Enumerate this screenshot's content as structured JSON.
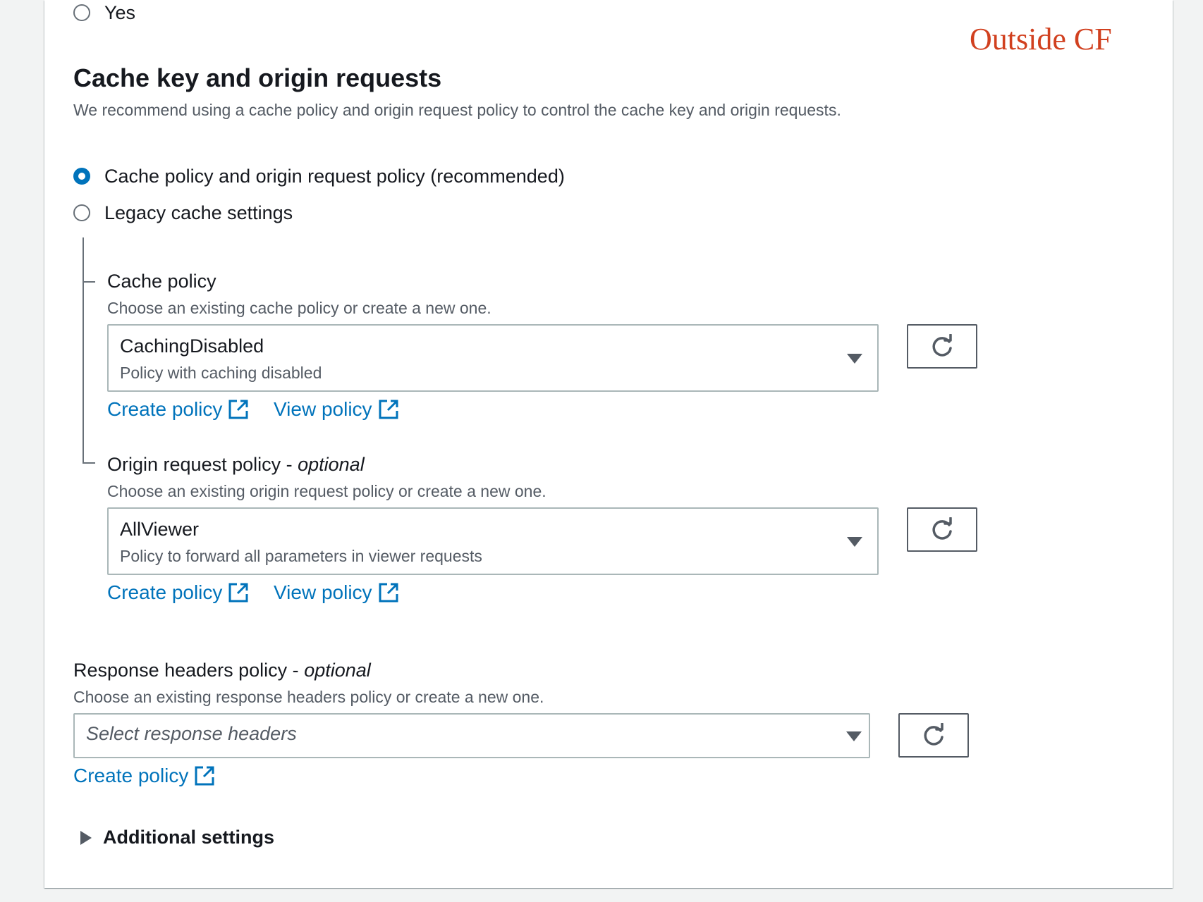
{
  "annotation": "Outside CF",
  "top_radio": {
    "label": "Yes"
  },
  "section": {
    "title": "Cache key and origin requests",
    "description": "We recommend using a cache policy and origin request policy to control the cache key and origin requests.",
    "options": [
      {
        "label": "Cache policy and origin request policy (recommended)",
        "checked": true
      },
      {
        "label": "Legacy cache settings",
        "checked": false
      }
    ]
  },
  "cache_policy": {
    "label": "Cache policy",
    "description": "Choose an existing cache policy or create a new one.",
    "selected": "CachingDisabled",
    "selected_description": "Policy with caching disabled",
    "create_link": "Create policy",
    "view_link": "View policy"
  },
  "origin_request_policy": {
    "label": "Origin request policy - ",
    "label_optional": "optional",
    "description": "Choose an existing origin request policy or create a new one.",
    "selected": "AllViewer",
    "selected_description": "Policy to forward all parameters in viewer requests",
    "create_link": "Create policy",
    "view_link": "View policy"
  },
  "response_headers_policy": {
    "label": "Response headers policy - ",
    "label_optional": "optional",
    "description": "Choose an existing response headers policy or create a new one.",
    "placeholder": "Select response headers",
    "create_link": "Create policy"
  },
  "additional_settings": {
    "label": "Additional settings"
  },
  "colors": {
    "accent": "#0073bb",
    "annotation": "#d1401f",
    "text": "#16191f",
    "muted": "#545b64"
  },
  "icons": {
    "refresh": "refresh-icon",
    "external": "external-link-icon",
    "caret": "caret-down-icon",
    "expand": "caret-right-icon"
  }
}
